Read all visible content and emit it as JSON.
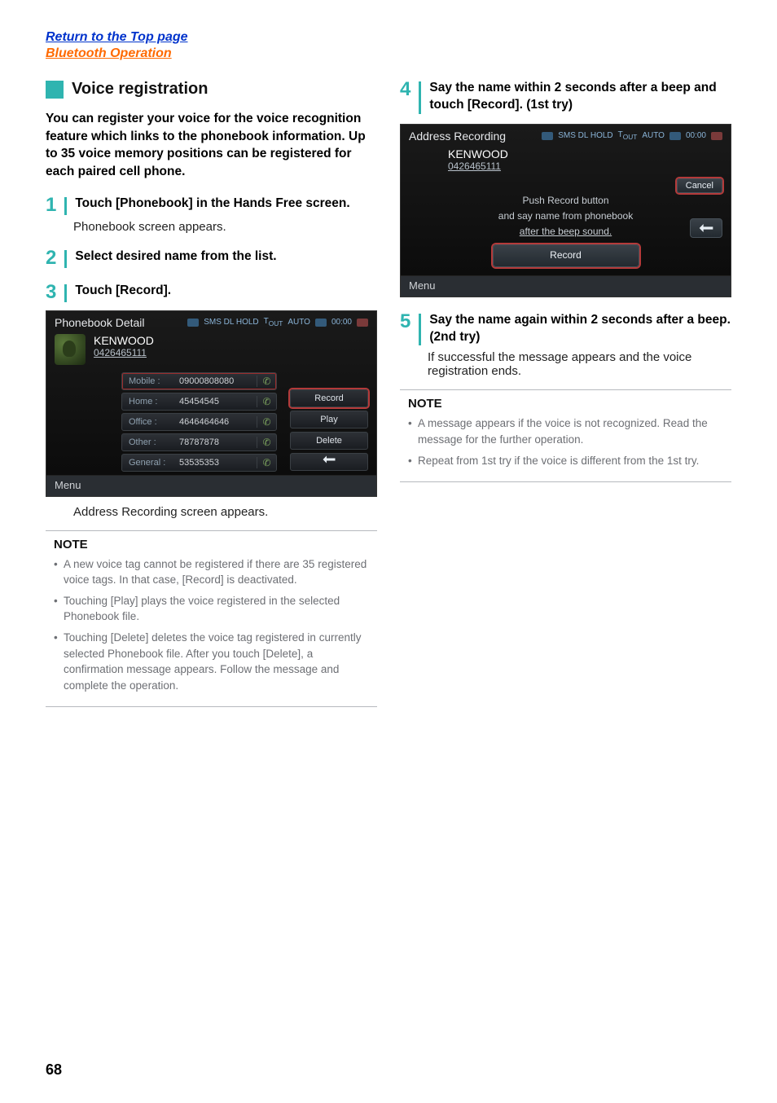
{
  "header": {
    "top_link": "Return to the Top page",
    "section_link": "Bluetooth Operation"
  },
  "section": {
    "title": "Voice registration",
    "lead": "You can register your voice for the voice recognition feature which links to the phonebook information. Up to 35 voice memory positions can be registered for each paired cell phone."
  },
  "steps_left": [
    {
      "num": "1",
      "text": "Touch [Phonebook] in the Hands Free screen.",
      "sub": "Phonebook screen appears."
    },
    {
      "num": "2",
      "text": "Select desired name from the list."
    },
    {
      "num": "3",
      "text": "Touch [Record]."
    }
  ],
  "phonebook_detail": {
    "title": "Phonebook Detail",
    "status_text": "SMS DL HOLD",
    "status_auto": "AUTO",
    "clock": "00:00",
    "entry_name": "KENWOOD",
    "entry_number": "0426465111",
    "rows": [
      {
        "label": "Mobile :",
        "value": "09000808080"
      },
      {
        "label": "Home :",
        "value": "45454545"
      },
      {
        "label": "Office :",
        "value": "4646464646"
      },
      {
        "label": "Other :",
        "value": "78787878"
      },
      {
        "label": "General :",
        "value": "53535353"
      }
    ],
    "actions": {
      "record": "Record",
      "play": "Play",
      "delete": "Delete"
    },
    "menu": "Menu"
  },
  "caption_left": "Address Recording screen appears.",
  "note_left": {
    "title": "NOTE",
    "items": [
      "A new voice tag cannot be registered if there are 35 registered voice tags. In that case, [Record] is deactivated.",
      "Touching [Play] plays the voice registered in the selected Phonebook file.",
      "Touching [Delete] deletes the voice tag registered in currently selected Phonebook file. After you touch [Delete], a confirmation message appears. Follow the message and complete the operation."
    ]
  },
  "steps_right": [
    {
      "num": "4",
      "text": "Say the name within 2 seconds after a beep and touch [Record]. (1st try)"
    },
    {
      "num": "5",
      "text": "Say the name again within 2 seconds after a beep. (2nd try)",
      "sub": "If successful the message appears and the voice registration ends."
    }
  ],
  "address_recording": {
    "title": "Address Recording",
    "status_text": "SMS DL HOLD",
    "status_auto": "AUTO",
    "clock": "00:00",
    "entry_name": "KENWOOD",
    "entry_number": "0426465111",
    "cancel": "Cancel",
    "line1": "Push Record button",
    "line2": "and say name from phonebook",
    "line3": "after the beep sound.",
    "record": "Record",
    "menu": "Menu"
  },
  "note_right": {
    "title": "NOTE",
    "items": [
      "A message appears if the voice is not recognized. Read the message for the further operation.",
      "Repeat from 1st try if the voice is different from the 1st try."
    ]
  },
  "page_number": "68"
}
